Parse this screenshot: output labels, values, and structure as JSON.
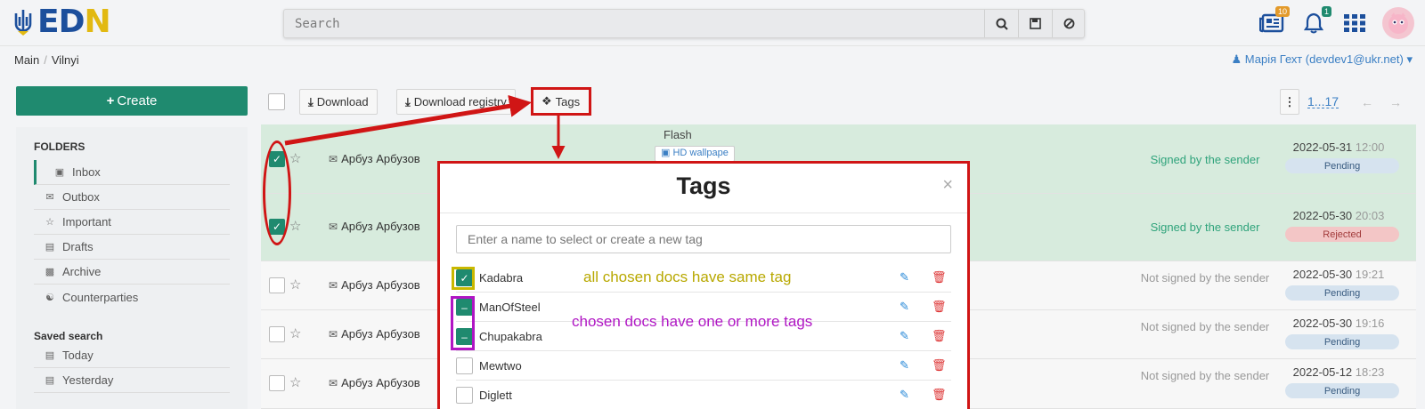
{
  "header": {
    "logo_text_e": "E",
    "logo_text_d": "D",
    "logo_text_n": "N",
    "search_placeholder": "Search",
    "search_button_icon": "search-icon",
    "save_button_icon": "save-icon",
    "clear_button_icon": "cancel-icon",
    "news_badge": "10",
    "notifications_badge": "1"
  },
  "breadcrumb": {
    "items": [
      "Main",
      "Vilnyi"
    ]
  },
  "user": {
    "label": "Марія Гехт (devdev1@ukr.net)"
  },
  "sidebar": {
    "create_label": "Create",
    "folders_title": "FOLDERS",
    "folders": [
      {
        "label": "Inbox",
        "icon": "inbox-icon"
      },
      {
        "label": "Outbox",
        "icon": "envelope-icon"
      },
      {
        "label": "Important",
        "icon": "star-icon"
      },
      {
        "label": "Drafts",
        "icon": "file-icon"
      },
      {
        "label": "Archive",
        "icon": "archive-icon"
      },
      {
        "label": "Counterparties",
        "icon": "handshake-icon"
      }
    ],
    "saved_title": "Saved search",
    "saved": [
      {
        "label": "Today",
        "icon": "file-icon"
      },
      {
        "label": "Yesterday",
        "icon": "file-icon"
      }
    ]
  },
  "toolbar": {
    "download_label": "Download",
    "download_registry_label": "Download registry",
    "tags_label": "Tags",
    "pager": "1...17"
  },
  "documents": [
    {
      "checked": true,
      "sender": "Арбуз Арбузов",
      "title": "Flash",
      "file": "HD wallpape",
      "status": "Signed by the sender",
      "date": "2022-05-31",
      "time": "12:00",
      "state": "Pending"
    },
    {
      "checked": true,
      "sender": "Арбуз Арбузов",
      "title": "",
      "file": "",
      "status": "Signed by the sender",
      "date": "2022-05-30",
      "time": "20:03",
      "state": "Rejected"
    },
    {
      "checked": false,
      "sender": "Арбуз Арбузов",
      "title": "",
      "file": "",
      "status": "Not signed by the sender",
      "date": "2022-05-30",
      "time": "19:21",
      "state": "Pending"
    },
    {
      "checked": false,
      "sender": "Арбуз Арбузов",
      "title": "",
      "file": "",
      "status": "Not signed by the sender",
      "date": "2022-05-30",
      "time": "19:16",
      "state": "Pending"
    },
    {
      "checked": false,
      "sender": "Арбуз Арбузов",
      "title": "",
      "file": "",
      "status": "Not signed by the sender",
      "date": "2022-05-12",
      "time": "18:23",
      "state": "Pending"
    }
  ],
  "modal": {
    "title": "Tags",
    "close": "×",
    "input_placeholder": "Enter a name to select or create a new tag",
    "tags": [
      {
        "name": "Kadabra",
        "state": "checked"
      },
      {
        "name": "ManOfSteel",
        "state": "partial"
      },
      {
        "name": "Chupakabra",
        "state": "partial"
      },
      {
        "name": "Mewtwo",
        "state": "unchecked"
      },
      {
        "name": "Diglett",
        "state": "unchecked"
      }
    ]
  },
  "annotations": {
    "same_tag_note": "all chosen docs have same tag",
    "one_or_more_note": "chosen docs have one or more tags",
    "colors": {
      "red": "#d01515",
      "yellow": "#c9b800",
      "purple": "#b016c4"
    }
  },
  "colors": {
    "accent": "#1f8a6f",
    "link": "#3b7fc4",
    "brand_blue": "#1c4f9c",
    "brand_yellow": "#e2b912"
  }
}
